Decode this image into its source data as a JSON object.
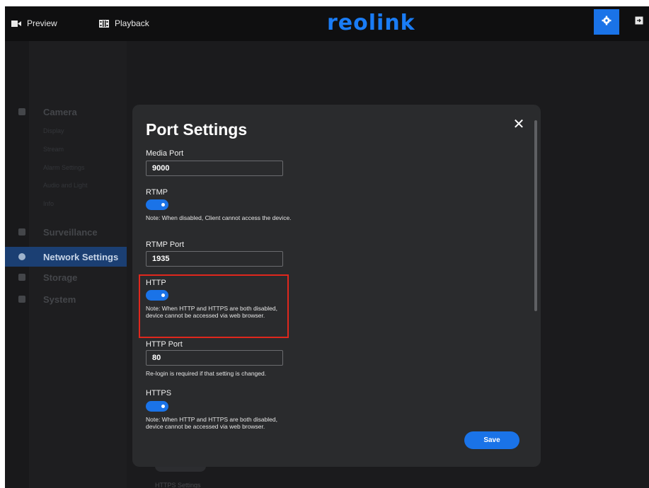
{
  "header": {
    "preview_label": "Preview",
    "playback_label": "Playback",
    "logo_text": "reolink",
    "accent_color": "#1a73e8"
  },
  "sidebar": {
    "items": [
      {
        "label": "Camera",
        "icon": "camera-icon"
      },
      {
        "label": "Surveillance",
        "icon": "shield-icon"
      },
      {
        "label": "Network Settings",
        "icon": "globe-icon",
        "active": true
      },
      {
        "label": "Storage",
        "icon": "storage-icon"
      },
      {
        "label": "System",
        "icon": "gear-icon"
      }
    ],
    "camera_sub_items": [
      "Display",
      "Stream",
      "Alarm Settings",
      "Audio and Light",
      "Info"
    ]
  },
  "modal": {
    "title": "Port Settings",
    "media_port": {
      "label": "Media Port",
      "value": "9000"
    },
    "rtmp": {
      "label": "RTMP",
      "enabled": true,
      "note": "Note: When disabled, Client cannot access the device."
    },
    "rtmp_port": {
      "label": "RTMP Port",
      "value": "1935"
    },
    "http": {
      "label": "HTTP",
      "enabled": true,
      "note": "Note: When HTTP and HTTPS are both disabled, device cannot be accessed via web browser."
    },
    "http_port": {
      "label": "HTTP Port",
      "value": "80",
      "note": "Re-login is required if that setting is changed."
    },
    "https": {
      "label": "HTTPS",
      "enabled": true,
      "note": "Note: When HTTP and HTTPS are both disabled, device cannot be accessed via web browser."
    },
    "save_label": "Save",
    "highlight_color": "#e0271d"
  },
  "background": {
    "https_settings_label": "HTTPS Settings"
  }
}
